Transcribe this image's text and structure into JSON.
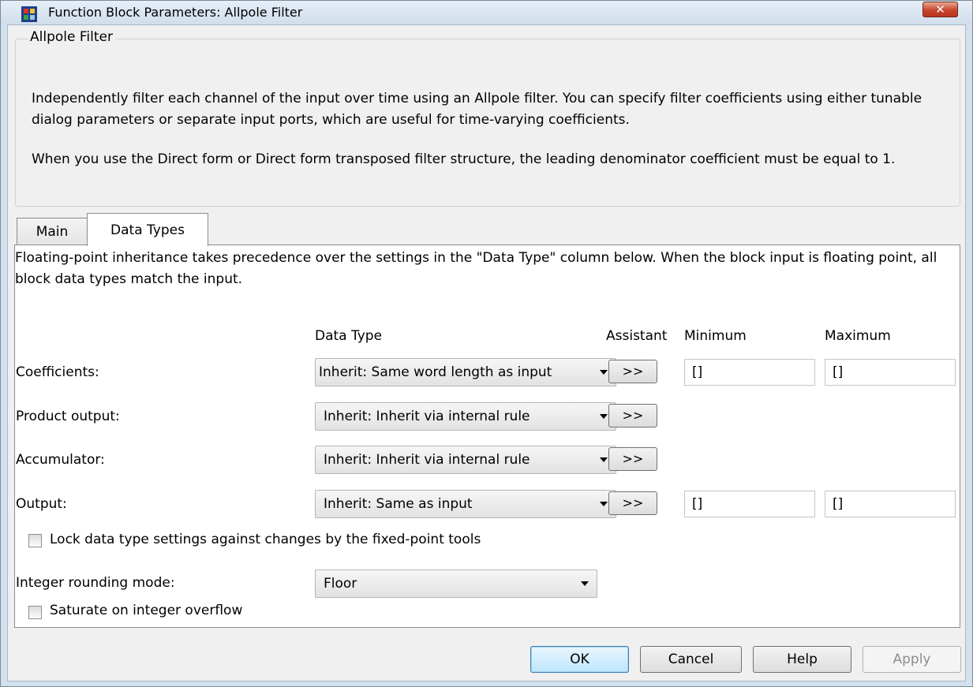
{
  "window": {
    "title": "Function Block Parameters: Allpole Filter",
    "close_glyph": "✕"
  },
  "group": {
    "legend": "Allpole Filter",
    "desc1": "Independently filter each channel of the input over time using an Allpole filter. You can specify filter coefficients using either tunable dialog parameters or separate input ports, which are useful for time-varying coefficients.",
    "desc2": "When you use the Direct form or Direct form transposed filter structure, the leading denominator coefficient must be equal to 1."
  },
  "tabs": [
    {
      "label": "Main"
    },
    {
      "label": "Data Types"
    }
  ],
  "panel": {
    "intro": "Floating-point inheritance takes precedence over the settings in the \"Data Type\" column below. When the block input is floating point, all block data types match the input.",
    "headers": {
      "data_type": "Data Type",
      "assistant": "Assistant",
      "minimum": "Minimum",
      "maximum": "Maximum"
    },
    "rows": [
      {
        "label": "Coefficients:",
        "datatype": "Inherit: Same word length as input",
        "assist": ">>",
        "min": "[]",
        "max": "[]"
      },
      {
        "label": "Product output:",
        "datatype": "Inherit: Inherit via internal rule",
        "assist": ">>"
      },
      {
        "label": "Accumulator:",
        "datatype": "Inherit: Inherit via internal rule",
        "assist": ">>"
      },
      {
        "label": "Output:",
        "datatype": "Inherit: Same as input",
        "assist": ">>",
        "min": "[]",
        "max": "[]"
      }
    ],
    "lock_label": "Lock data type settings against changes by the fixed-point tools",
    "rounding": {
      "label": "Integer rounding mode:",
      "value": "Floor"
    },
    "saturate_label": "Saturate on integer overflow"
  },
  "buttons": {
    "ok": "OK",
    "cancel": "Cancel",
    "help": "Help",
    "apply": "Apply"
  },
  "colors": {
    "frame": "#d3e1ef",
    "close": "#c7452c",
    "default_button": "#3c7fb1"
  }
}
